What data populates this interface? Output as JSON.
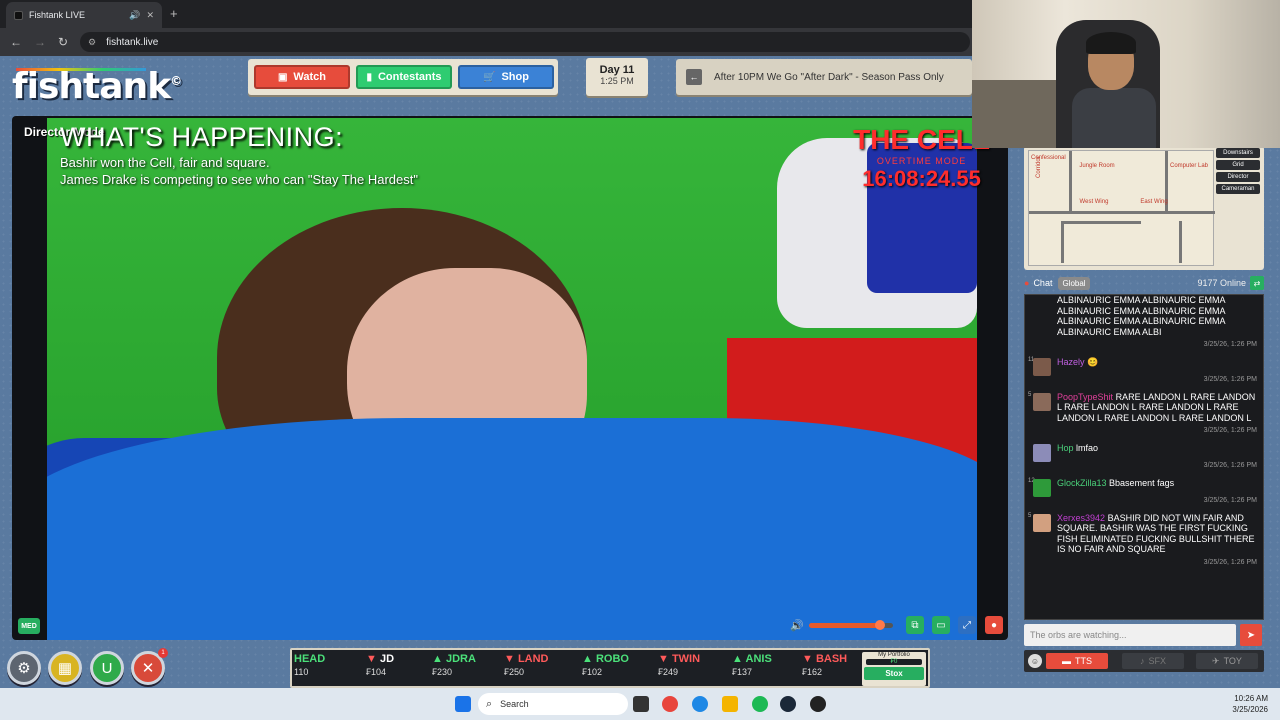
{
  "browser": {
    "tab_title": "Fishtank LIVE",
    "url": "fishtank.live"
  },
  "header": {
    "logo": "fishtank",
    "logo_mark": "©",
    "nav": [
      {
        "label": "Watch",
        "icon": "tv-icon",
        "color": "#e74c3c"
      },
      {
        "label": "Contestants",
        "icon": "contestants-icon",
        "color": "#2ecc71"
      },
      {
        "label": "Shop",
        "icon": "cart-icon",
        "color": "#3b82d6"
      }
    ],
    "day": "Day 11",
    "time": "1:25 PM",
    "ticker": "After 10PM We Go \"After Dark\" - Season Pass Only"
  },
  "player": {
    "mode_label": "Director Mode",
    "happening_title": "WHAT'S HAPPENING:",
    "happening_lines": [
      "Bashir won the Cell, fair and square.",
      "James Drake is competing to see who can \"Stay The Hardest\""
    ],
    "cell_title": "THE CELL",
    "cell_subtitle": "OVERTIME MODE",
    "cell_timer": "16:08:24.55",
    "quality_badge": "MED",
    "volume_level": 0.85
  },
  "dock": {
    "buttons": [
      {
        "name": "settings",
        "color": "#5d6570",
        "glyph": "⚙"
      },
      {
        "name": "inventory",
        "color": "#d8b422",
        "glyph": "▦"
      },
      {
        "name": "magnet",
        "color": "#2faa4a",
        "glyph": "U"
      },
      {
        "name": "tools",
        "color": "#d84a3a",
        "glyph": "✕",
        "badge": "1"
      }
    ],
    "stocks": [
      {
        "name": "HEAD",
        "price": "110",
        "trend": "none"
      },
      {
        "name": "JD",
        "price": "₣104",
        "trend": "down"
      },
      {
        "name": "JDRA",
        "price": "₣230",
        "trend": "up"
      },
      {
        "name": "LAND",
        "price": "₣250",
        "trend": "down"
      },
      {
        "name": "ROBO",
        "price": "₣102",
        "trend": "up"
      },
      {
        "name": "TWIN",
        "price": "₣249",
        "trend": "down"
      },
      {
        "name": "ANIS",
        "price": "₣137",
        "trend": "up"
      },
      {
        "name": "BASH",
        "price": "₣162",
        "trend": "down"
      }
    ],
    "portfolio_label": "My Portfolio",
    "portfolio_value": "₣0",
    "stox_button": "Stox"
  },
  "map": {
    "rooms": [
      "Confessional",
      "Corridor",
      "Jungle Room",
      "Computer Lab",
      "West Wing",
      "East Wing"
    ],
    "menu": [
      "Downstairs",
      "Grid",
      "Director",
      "Cameraman"
    ]
  },
  "chat": {
    "title": "Chat",
    "tab": "Global",
    "online": "9177 Online",
    "messages": [
      {
        "user": "",
        "user_color": "#c070ff",
        "level": "",
        "text": "ALBINAURIC EMMA ALBINAURIC EMMA ALBINAURIC EMMA ALBINAURIC EMMA ALBINAURIC EMMA ALBINAURIC EMMA ALBINAURIC EMMA ALBI",
        "time": "3/25/26, 1:26 PM",
        "avatar_color": "#1a1b1e"
      },
      {
        "user": "Hazely",
        "user_color": "#c060e0",
        "level": "11",
        "text": "😊",
        "time": "3/25/26, 1:26 PM",
        "avatar_color": "#7b5a4a"
      },
      {
        "user": "PoopTypeShit",
        "user_color": "#e0409a",
        "level": "5",
        "text": "RARE LANDON L RARE LANDON L RARE LANDON L RARE LANDON L RARE LANDON L RARE LANDON L RARE LANDON L",
        "time": "3/25/26, 1:26 PM",
        "avatar_color": "#8a6a5a"
      },
      {
        "user": "Hop",
        "user_color": "#4ad07a",
        "level": "",
        "text": "lmfao",
        "time": "3/25/26, 1:26 PM",
        "avatar_color": "#8c8cb8"
      },
      {
        "user": "GlockZilla13",
        "user_color": "#4ad07a",
        "level": "12",
        "text": "Bbasement fags",
        "time": "3/25/26, 1:26 PM",
        "avatar_color": "#2e9a3a"
      },
      {
        "user": "Xerxes3942",
        "user_color": "#c040d0",
        "level": "5",
        "text": "BASHIR DID NOT WIN FAIR AND SQUARE. BASHIR WAS THE FIRST FUCKING FISH ELIMINATED FUCKING BULLSHIT THERE IS NO FAIR AND SQUARE",
        "time": "3/25/26, 1:26 PM",
        "avatar_color": "#d2a080"
      }
    ],
    "input_placeholder": "The orbs are watching...",
    "tts": "TTS",
    "sfx": "SFX",
    "toy": "TOY"
  },
  "taskbar": {
    "search": "Search",
    "time": "10:26 AM",
    "date": "3/25/2026"
  }
}
